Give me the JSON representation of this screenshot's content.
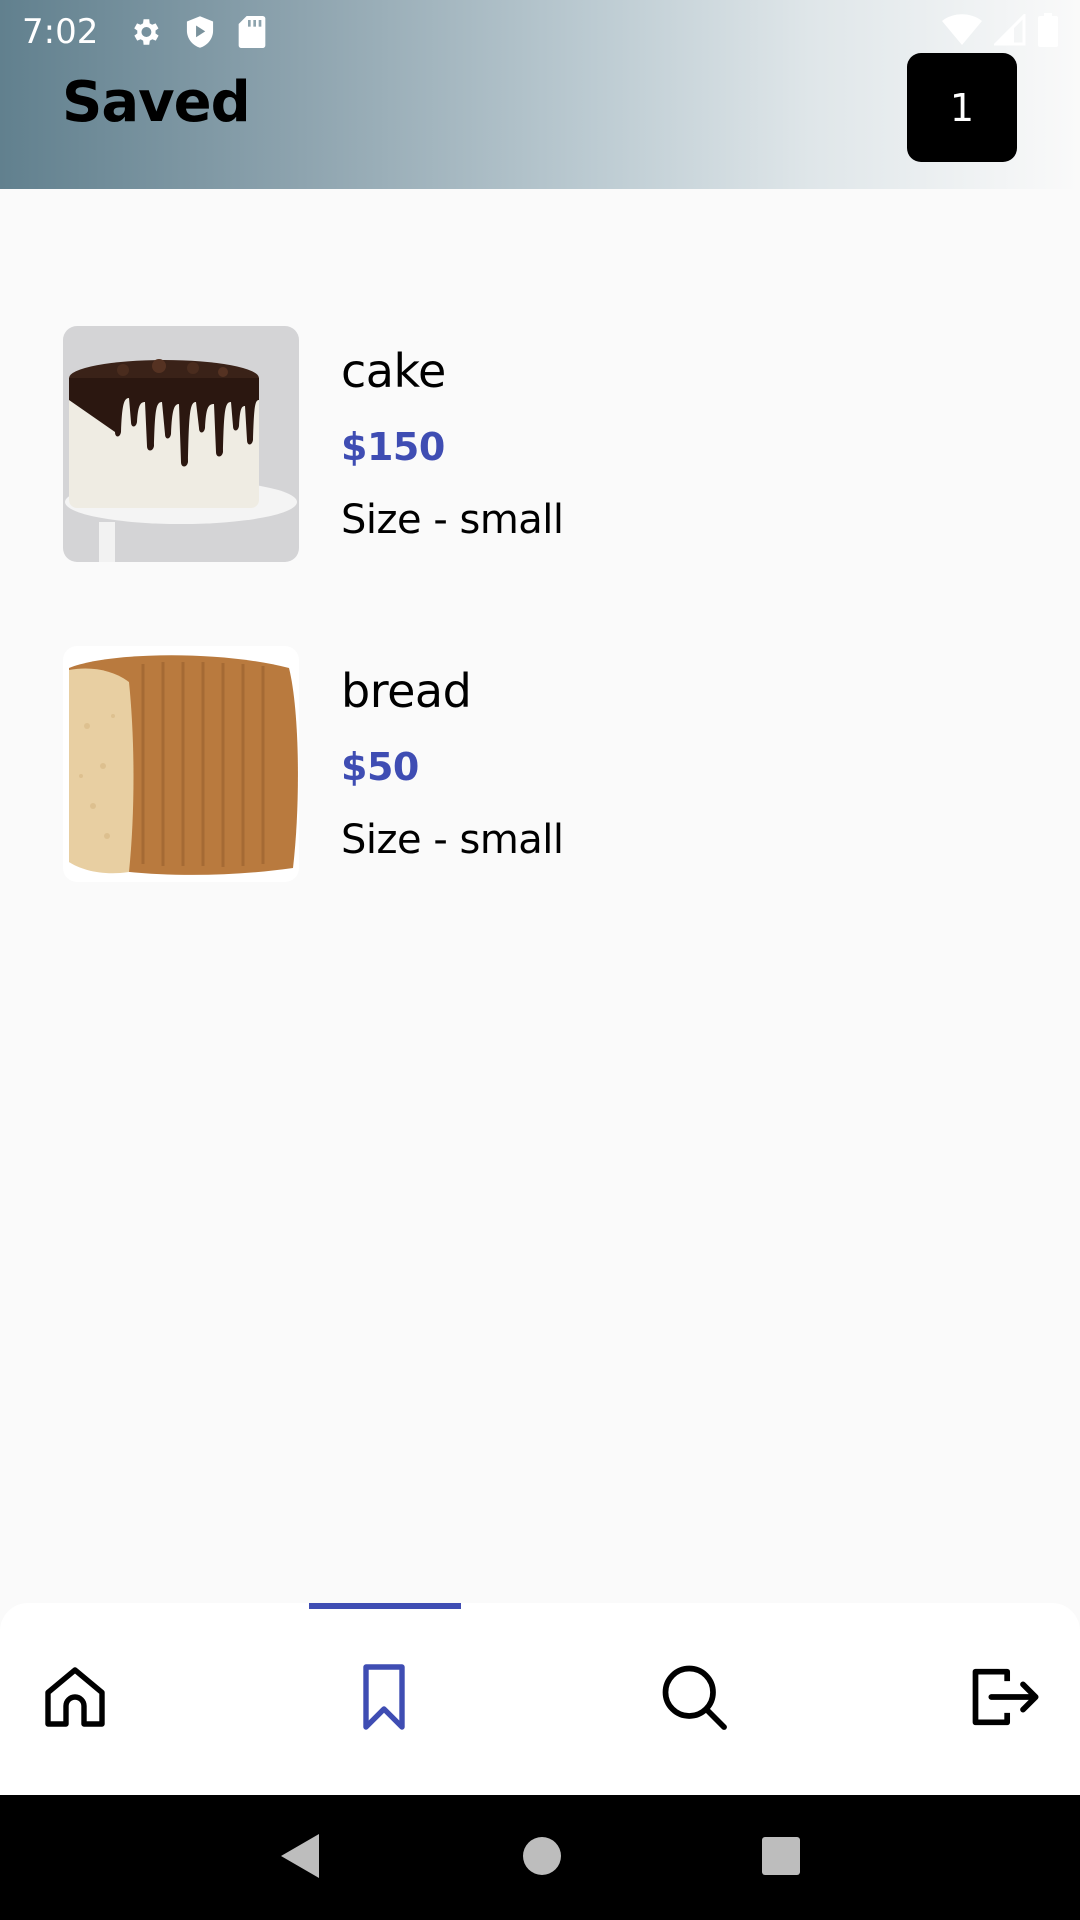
{
  "status_bar": {
    "time": "7:02"
  },
  "header": {
    "title": "Saved",
    "badge_count": "1"
  },
  "saved_items": [
    {
      "name": "cake",
      "price": "$150",
      "size": "Size - small",
      "image": "chocolate-drip-cake"
    },
    {
      "name": "bread",
      "price": "$50",
      "size": "Size - small",
      "image": "sliced-bread-loaf"
    }
  ],
  "bottom_nav": {
    "items": [
      {
        "icon": "home-icon",
        "active": false
      },
      {
        "icon": "bookmark-icon",
        "active": true
      },
      {
        "icon": "search-icon",
        "active": false
      },
      {
        "icon": "logout-icon",
        "active": false
      }
    ]
  },
  "colors": {
    "accent": "#3f4db3",
    "header_gradient_start": "#61808e",
    "badge_bg": "#000000"
  }
}
